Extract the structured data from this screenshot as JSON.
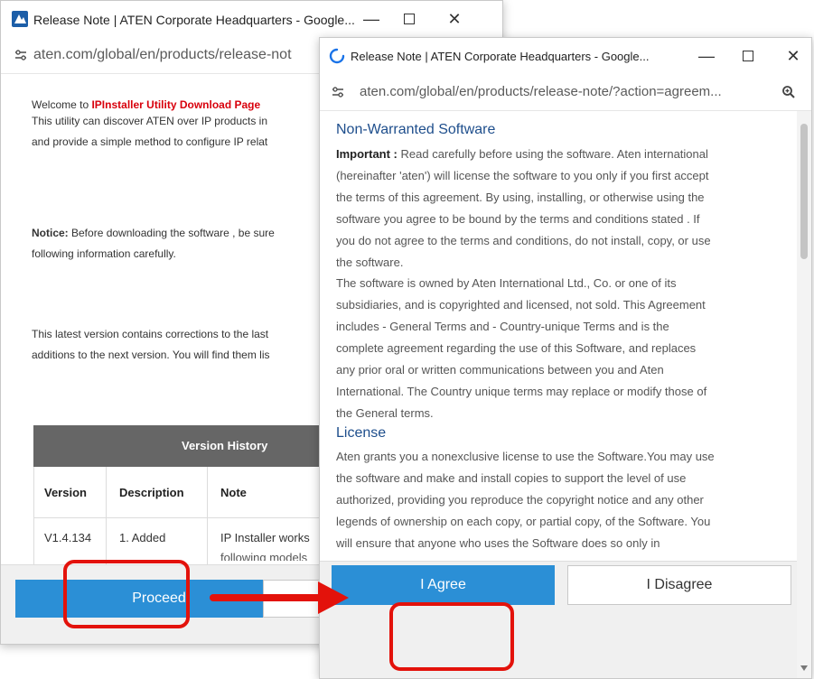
{
  "colors": {
    "accent": "#2b8fd6",
    "highlight": "#e3120b",
    "notice_red": "#d8000c",
    "table_header_bg": "#666666"
  },
  "window1": {
    "title": "Release Note | ATEN Corporate Headquarters - Google...",
    "url": "aten.com/global/en/products/release-not",
    "welcome_prefix": "Welcome to ",
    "welcome_highlight": "IPInstaller Utility Download Page",
    "intro_line1": "This utility can discover ATEN over IP products in",
    "intro_line2": "and provide a simple method to configure IP relat",
    "notice_label": "Notice:",
    "notice_line1": " Before downloading the software , be sure",
    "notice_line2": "following information carefully.",
    "latest_line1": "This latest version contains corrections to the last",
    "latest_line2": "additions to the next version. You will find them lis",
    "table": {
      "title": "Version History",
      "headers": [
        "Version",
        "Description",
        "Note"
      ],
      "row": {
        "version": "V1.4.134",
        "description": "1. Added",
        "note": "IP Installer works",
        "note_cont": "following models"
      }
    },
    "proceed_label": "Proceed"
  },
  "window2": {
    "title": "Release Note | ATEN Corporate Headquarters - Google...",
    "url": "aten.com/global/en/products/release-note/?action=agreem...",
    "heading": "Non-Warranted Software",
    "important_label": "Important :",
    "lines": [
      " Read carefully before using the software. Aten international",
      "(hereinafter 'aten') will license the software to you only if you first accept",
      "the terms of this agreement. By using, installing, or otherwise using the",
      "software you agree to be bound by the terms and conditions stated . If",
      "you do not agree to the terms and conditions, do not install, copy, or use",
      "the software.",
      "The software is owned by Aten International Ltd., Co. or one of its",
      "subsidiaries, and is copyrighted and licensed, not sold. This Agreement",
      "includes - General Terms and - Country-unique Terms and is the",
      "complete agreement regarding the use of this Software, and replaces",
      "any prior oral or written communications between you and Aten",
      "International. The Country unique terms may replace or modify those of",
      "the General terms."
    ],
    "license_heading": "License",
    "license_lines": [
      "Aten grants you a nonexclusive license to use the Software.You may use",
      "the software and make and install copies to support the level of use",
      "authorized, providing you reproduce the copyright notice and any other",
      "legends of ownership on each copy, or partial copy, of the Software. You",
      "will ensure that anyone who uses the Software does so only in"
    ],
    "agree_label": "I Agree",
    "disagree_label": "I Disagree"
  }
}
